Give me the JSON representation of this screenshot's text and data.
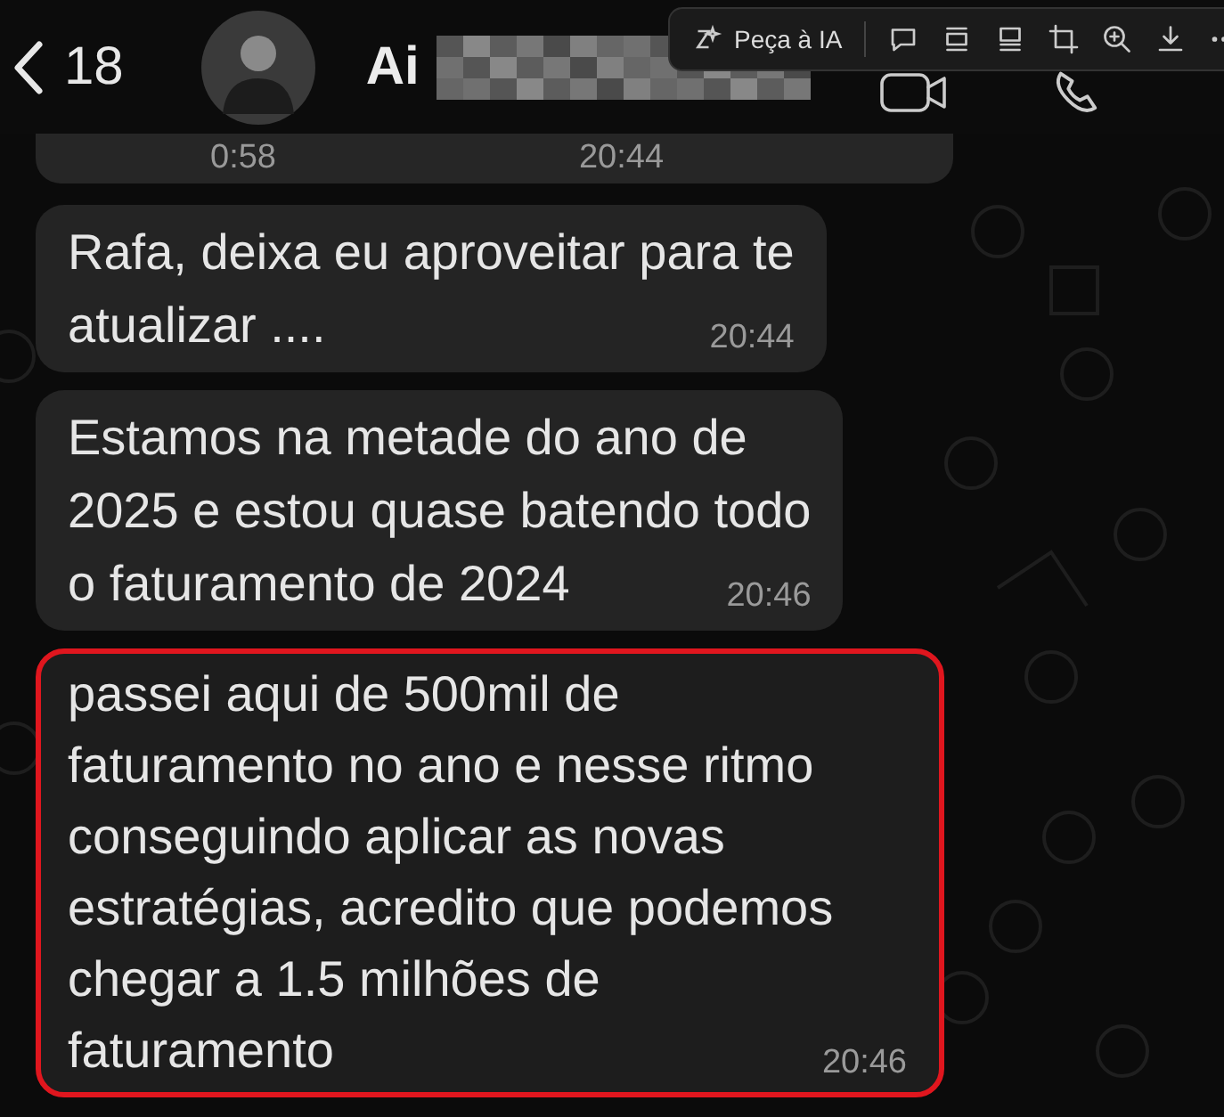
{
  "header": {
    "back_count": "18",
    "contact_name": "Ai"
  },
  "toolbar": {
    "ai_label": "Peça à IA"
  },
  "messages": [
    {
      "kind": "voice",
      "duration": "0:58",
      "time": "20:44",
      "highlighted": false
    },
    {
      "kind": "text",
      "lines": [
        "Rafa, deixa eu aproveitar para te",
        "atualizar ...."
      ],
      "time": "20:44",
      "highlighted": false
    },
    {
      "kind": "text",
      "lines": [
        "Estamos na metade do ano de",
        "2025 e estou quase batendo todo",
        "o faturamento de 2024"
      ],
      "time": "20:46",
      "highlighted": false
    },
    {
      "kind": "text",
      "lines": [
        "passei aqui de 500mil de",
        "faturamento no ano e nesse ritmo",
        "conseguindo aplicar as novas",
        "estratégias, acredito que podemos",
        "chegar a 1.5 milhões de",
        "faturamento"
      ],
      "time": "20:46",
      "highlighted": true
    }
  ]
}
